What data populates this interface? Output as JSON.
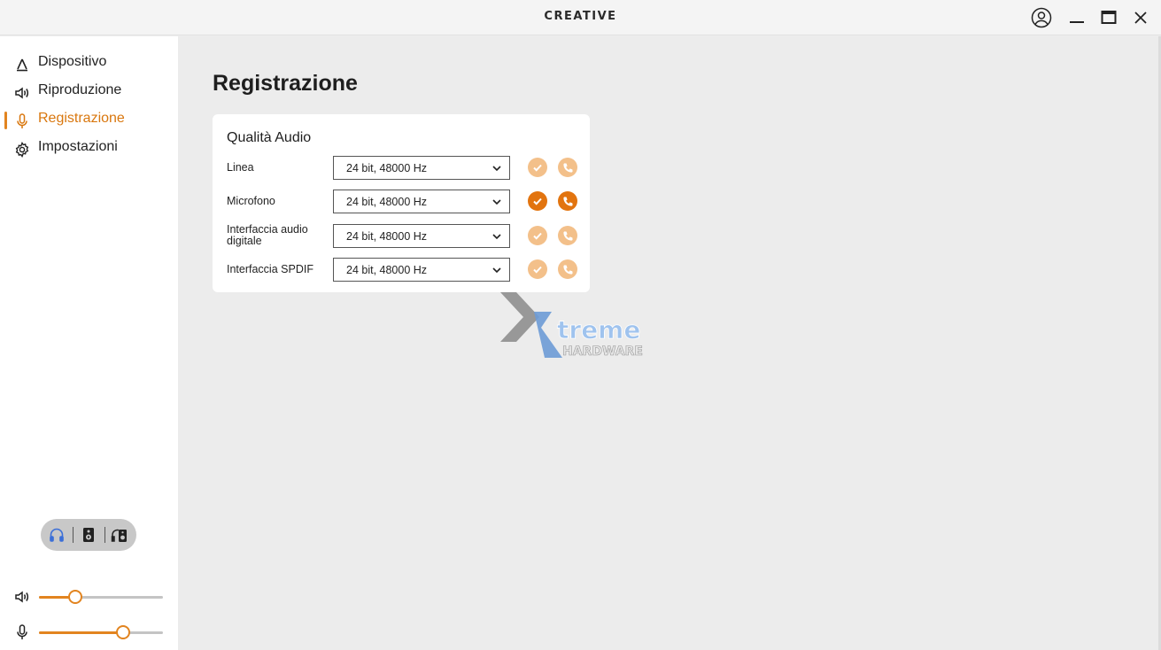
{
  "app": {
    "brand": "CREATIVE"
  },
  "window_controls": {
    "account_icon": "user-circle-icon",
    "minimize_icon": "minimize-icon",
    "maximize_icon": "maximize-icon",
    "close_icon": "close-icon"
  },
  "sidebar": {
    "items": [
      {
        "label": "Dispositivo",
        "icon": "device-triangle-icon",
        "active": false
      },
      {
        "label": "Riproduzione",
        "icon": "speaker-icon",
        "active": false
      },
      {
        "label": "Registrazione",
        "icon": "microphone-icon",
        "active": true
      },
      {
        "label": "Impostazioni",
        "icon": "gear-icon",
        "active": false
      }
    ],
    "output_modes": [
      "headphones-icon",
      "speaker-box-icon",
      "headphone-speaker-icon"
    ],
    "playback_volume": 0.29,
    "mic_volume": 0.68
  },
  "main": {
    "title": "Registrazione",
    "card": {
      "title": "Qualità Audio",
      "rows": [
        {
          "label": "Linea",
          "value": "24 bit, 48000 Hz",
          "active": false
        },
        {
          "label": "Microfono",
          "value": "24 bit, 48000 Hz",
          "active": true
        },
        {
          "label": "Interfaccia audio digitale",
          "value": "24 bit, 48000 Hz",
          "active": false
        },
        {
          "label": "Interfaccia SPDIF",
          "value": "24 bit, 48000 Hz",
          "active": false
        }
      ]
    }
  },
  "watermark": {
    "line1": "treme",
    "line2": "HARDWARE"
  },
  "colors": {
    "accent": "#e2841f",
    "accent_dim": "#f3c08a",
    "accent_on": "#e2740f",
    "headphones_active": "#3b6fd8"
  }
}
